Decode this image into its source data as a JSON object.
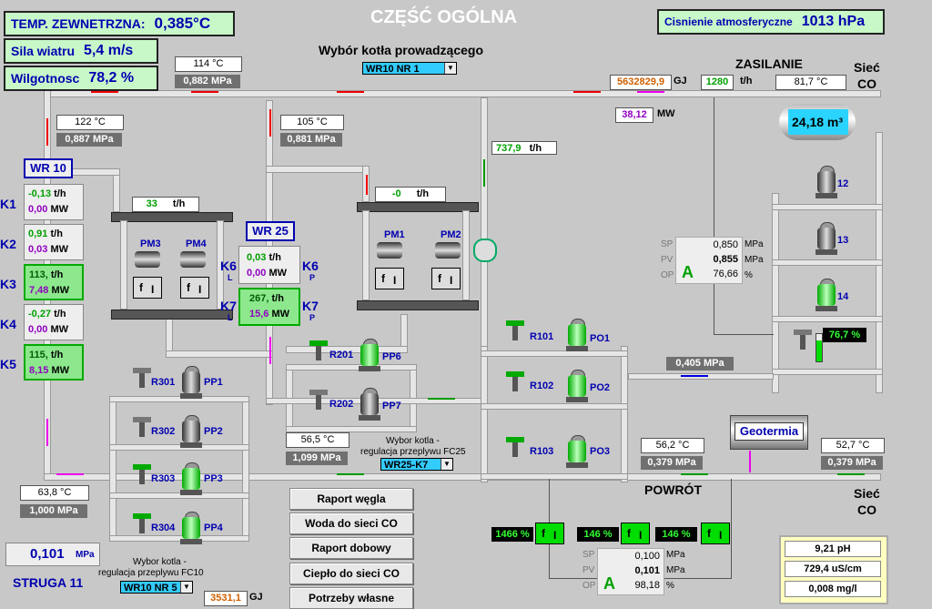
{
  "header": {
    "title": "CZĘŚĆ OGÓLNA",
    "temp_label": "TEMP. ZEWNETRZNA:",
    "temp_value": "0,385°C",
    "wind_label": "Sila wiatru",
    "wind_value": "5,4 m/s",
    "humidity_label": "Wilgotnosc",
    "humidity_value": "78,2 %",
    "pressure_label": "Cisnienie atmosferyczne",
    "pressure_value": "1013 hPa"
  },
  "boiler_select": {
    "label": "Wybór kotła prowadzącego",
    "value": "WR10 NR 1"
  },
  "supply": {
    "label": "ZASILANIE",
    "siec_co_1": "Sieć",
    "siec_co_2": "CO",
    "energy": "5632829,9",
    "energy_unit": "GJ",
    "flow": "1280",
    "flow_unit": "t/h",
    "temp": "81,7 °C",
    "power": "38,12",
    "power_unit": "MW",
    "tank": "24,18 m³"
  },
  "wr10_out": {
    "temp": "114 °C",
    "press": "0,882 MPa"
  },
  "wr10_in": {
    "temp": "122 °C",
    "press": "0,887 MPa"
  },
  "wr25_out": {
    "temp": "105 °C",
    "press": "0,881 MPa"
  },
  "flow_7379": {
    "value": "737,9",
    "unit": "t/h"
  },
  "pm_flow": {
    "value": "-0",
    "unit": "t/h"
  },
  "pm3_flow": {
    "value": "33",
    "unit": "t/h"
  },
  "wr10": {
    "label": "WR 10",
    "boilers": [
      {
        "name": "K1",
        "flow": "-0,13",
        "power": "0,00"
      },
      {
        "name": "K2",
        "flow": "0,91",
        "power": "0,03"
      },
      {
        "name": "K3",
        "flow": "113,",
        "power": "7,48"
      },
      {
        "name": "K4",
        "flow": "-0,27",
        "power": "0,00"
      },
      {
        "name": "K5",
        "flow": "115,",
        "power": "8,15"
      }
    ],
    "flow_unit": "t/h",
    "power_unit": "MW"
  },
  "wr25": {
    "label": "WR 25",
    "k6": {
      "name": "K6",
      "sub_l": "L",
      "sub_p": "P",
      "flow": "0,03",
      "power": "0,00"
    },
    "k7": {
      "name": "K7",
      "sub_l": "L",
      "sub_p": "P",
      "flow": "267,",
      "power": "15,6"
    },
    "flow_unit": "t/h",
    "power_unit": "MW"
  },
  "pumps": {
    "pm3": "PM3",
    "pm4": "PM4",
    "pm1": "PM1",
    "pm2": "PM2",
    "pp1": "PP1",
    "pp2": "PP2",
    "pp3": "PP3",
    "pp4": "PP4",
    "pp6": "PP6",
    "pp7": "PP7",
    "po1": "PO1",
    "po2": "PO2",
    "po3": "PO3",
    "p12": "12",
    "p13": "13",
    "p14": "14"
  },
  "valves": {
    "r301": "R301",
    "r302": "R302",
    "r303": "R303",
    "r304": "R304",
    "r201": "R201",
    "r202": "R202",
    "r101": "R101",
    "r102": "R102",
    "r103": "R103"
  },
  "fi_label_f": "f",
  "fi_label_i": "I",
  "controller_top": {
    "sp_label": "SP",
    "pv_label": "PV",
    "op_label": "OP",
    "sp": "0,850",
    "pv": "0,855",
    "op": "76,66",
    "sp_unit": "MPa",
    "pv_unit": "MPa",
    "op_unit": "%",
    "mode": "A"
  },
  "controller_bottom": {
    "sp_label": "SP",
    "pv_label": "PV",
    "op_label": "OP",
    "sp": "0,100",
    "pv": "0,101",
    "op": "98,18",
    "sp_unit": "MPa",
    "pv_unit": "MPa",
    "op_unit": "%",
    "mode": "A"
  },
  "valve_767": "76,7 %",
  "mid_pressure": "0,405 MPa",
  "geotermia": "Geotermia",
  "return": {
    "label": "POWRÓT",
    "siec_co_1": "Sieć",
    "siec_co_2": "CO",
    "temp_mid": "56,2 °C",
    "press_mid": "0,379 MPa",
    "temp_right": "52,7 °C",
    "press_right": "0,379 MPa"
  },
  "wr25_return": {
    "temp": "56,5 °C",
    "press": "1,099 MPa"
  },
  "fc25_select": {
    "label1": "Wybor kotla -",
    "label2": "regulacja przeplywu FC25",
    "value": "WR25-K7"
  },
  "fc10_select": {
    "label1": "Wybor kotla -",
    "label2": "regulacja przeplywu FC10",
    "value": "WR10 NR 5"
  },
  "wr10_return": {
    "temp": "63,8 °C",
    "press": "1,000 MPa"
  },
  "pct_1466": "1466 %",
  "pct_146a": "146 %",
  "pct_146b": "146 %",
  "struga": {
    "value": "0,101",
    "unit": "MPa",
    "label": "STRUGA 11"
  },
  "energy_bottom": {
    "value": "3531,1",
    "unit": "GJ"
  },
  "buttons": [
    "Raport węgla",
    "Woda do sieci CO",
    "Raport dobowy",
    "Ciepło do sieci CO",
    "Potrzeby własne"
  ],
  "water": {
    "ph": "9,21 pH",
    "cond": "729,4 uS/cm",
    "o2": "0,008 mg/l"
  },
  "colors": {
    "background": "#c8c8c8",
    "label_blue": "#0000b0",
    "good_green": "#00a000",
    "value_purple": "#9000c0"
  }
}
